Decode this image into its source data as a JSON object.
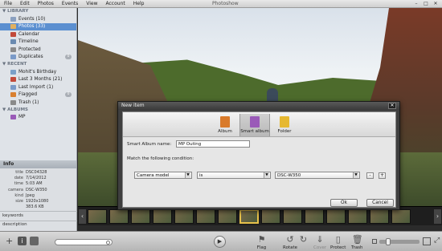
{
  "app": {
    "title": "Photoshow",
    "menu": [
      "File",
      "Edit",
      "Photos",
      "Events",
      "View",
      "Account",
      "Help"
    ]
  },
  "sidebar": {
    "library_header": "LIBRARY",
    "library": [
      {
        "label": "Events (10)",
        "icon": "events-icon",
        "color": "#8aa0c0"
      },
      {
        "label": "Photos (33)",
        "icon": "photos-icon",
        "color": "#e0b060",
        "selected": true
      },
      {
        "label": "Calendar",
        "icon": "calendar-icon",
        "color": "#c24a3a"
      },
      {
        "label": "Timeline",
        "icon": "timeline-icon",
        "color": "#6a8ab0"
      },
      {
        "label": "Protected",
        "icon": "lock-icon",
        "color": "#8a8a8a"
      },
      {
        "label": "Duplicates",
        "icon": "duplicates-icon",
        "color": "#7a9ac8",
        "badge": "0"
      }
    ],
    "recent_header": "RECENT",
    "recent": [
      {
        "label": "Mohit's Birthday",
        "icon": "event-icon",
        "color": "#7aa0c8"
      },
      {
        "label": "Last 3 Months (21)",
        "icon": "calendar-icon",
        "color": "#c24a3a"
      },
      {
        "label": "Last Import (1)",
        "icon": "import-icon",
        "color": "#7a9ac8"
      },
      {
        "label": "Flagged",
        "icon": "flag-icon",
        "color": "#d98030",
        "badge": "0"
      },
      {
        "label": "Trash (1)",
        "icon": "trash-icon",
        "color": "#8a8a8a"
      }
    ],
    "albums_header": "ALBUMS",
    "albums": [
      {
        "label": "MP",
        "icon": "smart-album-icon",
        "color": "#9a5ab8"
      }
    ]
  },
  "info": {
    "header": "Info",
    "rows": [
      {
        "k": "title",
        "v": "DSC04328"
      },
      {
        "k": "date",
        "v": "7/14/2012"
      },
      {
        "k": "time",
        "v": "5:03 AM"
      },
      {
        "k": "camera",
        "v": "DSC-W350"
      },
      {
        "k": "kind",
        "v": "Jpeg"
      },
      {
        "k": "size",
        "v": "1920x1080"
      },
      {
        "k": "",
        "v": "383.6 KB"
      }
    ],
    "keywords": "keywords",
    "description": "description"
  },
  "dialog": {
    "title": "New item",
    "close": "✕",
    "tabs": [
      {
        "label": "Album",
        "color": "#d97a2a"
      },
      {
        "label": "Smart album",
        "color": "#9a5ab8",
        "selected": true
      },
      {
        "label": "Folder",
        "color": "#e6b830"
      }
    ],
    "name_label": "Smart Album name:",
    "name_value": "MP Outing",
    "match_label": "Match the following condition:",
    "field": "Camera model",
    "operator": "is",
    "value": "DSC-W350",
    "minus": "-",
    "plus": "+",
    "ok": "Ok",
    "cancel": "Cancel"
  },
  "toolbar": {
    "flag": "Flag",
    "rotate": "Rotate",
    "cover": "Cover",
    "protect": "Protect",
    "trash": "Trash"
  },
  "filmstrip": {
    "count": 15,
    "selected_index": 7
  }
}
